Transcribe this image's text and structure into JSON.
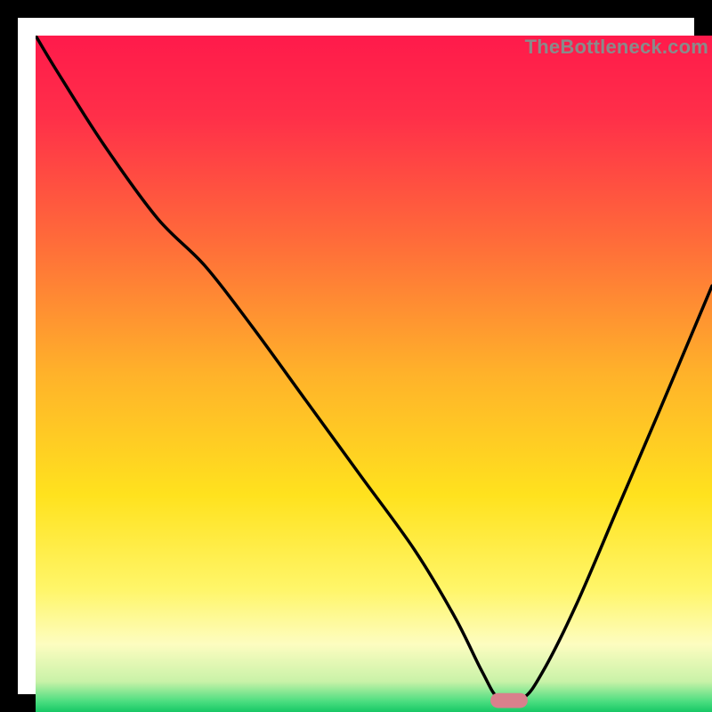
{
  "watermark": "TheBottleneck.com",
  "chart_data": {
    "type": "line",
    "title": "",
    "xlabel": "",
    "ylabel": "",
    "xlim": [
      0,
      100
    ],
    "ylim": [
      0,
      100
    ],
    "gradient_stops": [
      {
        "offset": 0.0,
        "color": "#ff1a4b"
      },
      {
        "offset": 0.12,
        "color": "#ff2f49"
      },
      {
        "offset": 0.3,
        "color": "#ff6a3a"
      },
      {
        "offset": 0.5,
        "color": "#ffb22a"
      },
      {
        "offset": 0.68,
        "color": "#ffe21e"
      },
      {
        "offset": 0.82,
        "color": "#fff66a"
      },
      {
        "offset": 0.9,
        "color": "#fdfdc0"
      },
      {
        "offset": 0.955,
        "color": "#c9f2a8"
      },
      {
        "offset": 0.985,
        "color": "#49dd7f"
      },
      {
        "offset": 1.0,
        "color": "#17c765"
      }
    ],
    "series": [
      {
        "name": "bottleneck-curve",
        "color": "#000000",
        "x": [
          0,
          3,
          10,
          18,
          25,
          32,
          40,
          48,
          56,
          62,
          66,
          68.5,
          72,
          75,
          80,
          86,
          92,
          100
        ],
        "y": [
          100,
          95,
          84,
          73,
          66,
          57,
          46,
          35,
          24,
          14,
          6,
          2,
          2,
          6,
          16,
          30,
          44,
          63
        ]
      }
    ],
    "marker": {
      "name": "optimal-point",
      "x_center": 70,
      "y_center": 1.7,
      "width": 5.5,
      "height": 2.2,
      "color": "#d9808c"
    }
  }
}
